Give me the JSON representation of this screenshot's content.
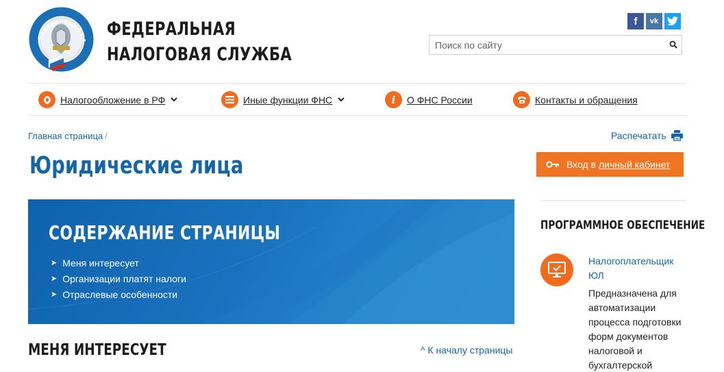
{
  "header": {
    "brand_line1": "ФЕДЕРАЛЬНАЯ",
    "brand_line2": "НАЛОГОВАЯ СЛУЖБА",
    "logo_text": "ФЕДЕРАЛЬНАЯ НАЛОГОВАЯ СЛУЖБА",
    "social": [
      "f",
      "vk",
      "t"
    ],
    "search_placeholder": "Поиск по сайту"
  },
  "nav": {
    "items": [
      {
        "label": "Налогообложение в РФ",
        "icon": "emblem-icon",
        "has_dropdown": true
      },
      {
        "label": "Иные функции ФНС",
        "icon": "menu-icon",
        "has_dropdown": true
      },
      {
        "label": "О ФНС России",
        "icon": "info-icon",
        "has_dropdown": false
      },
      {
        "label": "Контакты и обращения",
        "icon": "phone-icon",
        "has_dropdown": false
      }
    ]
  },
  "breadcrumb": {
    "home": "Главная страница",
    "separator": "/"
  },
  "print_label": "Распечатать",
  "page_title": "Юридические лица",
  "cabinet": {
    "prefix": "Вход в",
    "link": "личный кабинет"
  },
  "banner": {
    "title": "СОДЕРЖАНИЕ СТРАНИЦЫ",
    "items": [
      "Меня интересует",
      "Организации платят налоги",
      "Отраслевые особенности"
    ]
  },
  "section": {
    "title": "МЕНЯ ИНТЕРЕСУЕТ",
    "to_top": "^ К началу страницы"
  },
  "sidebar": {
    "title": "ПРОГРАММНОЕ ОБЕСПЕЧЕНИЕ",
    "software_link": "Налогоплательщик ЮЛ",
    "software_desc": "Предназначена для автоматизации процесса подготовки форм документов налоговой и бухгалтерской"
  },
  "colors": {
    "accent": "#f06a20",
    "link": "#1565a8",
    "banner": "#1a72bd"
  }
}
